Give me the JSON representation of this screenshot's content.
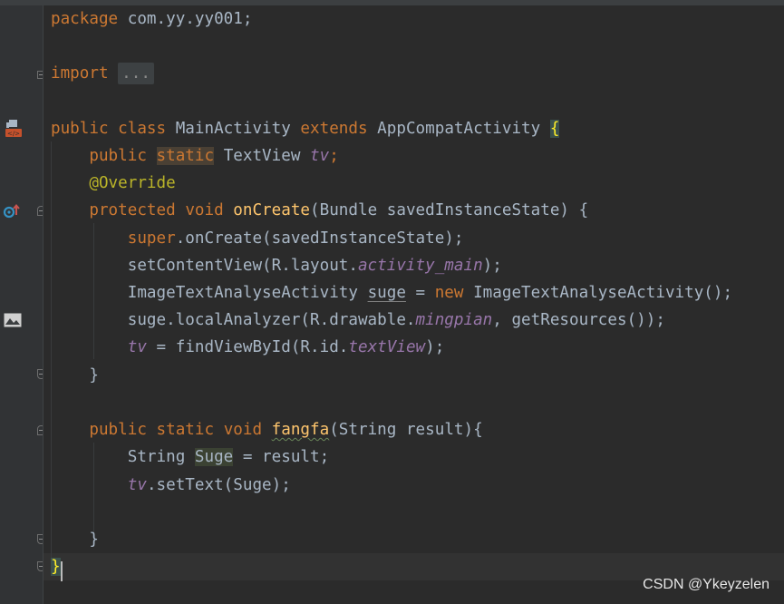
{
  "editor": {
    "lines": {
      "package": {
        "kw": "package",
        "rest": " com.yy.yy001;"
      },
      "import": {
        "kw": "import",
        "folded": "..."
      },
      "class_decl": {
        "kw1": "public",
        "kw2": "class",
        "name": "MainActivity",
        "kw3": "extends",
        "parent": "AppCompatActivity",
        "brace": "{"
      },
      "field_decl": {
        "kw1": "public",
        "kw2": "static",
        "type": "TextView",
        "field": "tv",
        "end": ";"
      },
      "override": {
        "text": "@Override"
      },
      "oncreate_decl": {
        "kw1": "protected",
        "kw2": "void",
        "name": "onCreate",
        "params": "(Bundle savedInstanceState) {"
      },
      "super_call": {
        "kw": "super",
        "rest": ".onCreate(savedInstanceState);"
      },
      "set_content": {
        "pre": "setContentView(R.layout.",
        "field": "activity_main",
        "post": ");"
      },
      "image_text": {
        "pre": "ImageTextAnalyseActivity ",
        "var": "suge",
        "mid": " = ",
        "kw": "new",
        "post": " ImageTextAnalyseActivity();"
      },
      "local_analyzer": {
        "pre": "suge.localAnalyzer(R.drawable.",
        "field": "mingpian",
        "post": ", getResources());"
      },
      "find_view": {
        "field": "tv",
        "pre": " = findViewById(R.id.",
        "field2": "textView",
        "post": ");"
      },
      "close1": {
        "text": "}"
      },
      "fangfa_decl": {
        "kw1": "public",
        "kw2": "static",
        "kw3": "void",
        "name": "fangfa",
        "params": "(String result){"
      },
      "string_decl": {
        "pre": "String ",
        "var": "Suge",
        "post": " = result;"
      },
      "set_text": {
        "field": "tv",
        "post": ".setText(Suge);"
      },
      "close2": {
        "text": "}"
      },
      "close_class": {
        "text": "}"
      }
    }
  },
  "watermark": "CSDN @Ykeyzelen",
  "icons": {
    "class_marker": "android-class-icon",
    "override_marker": "override-method-icon",
    "image_marker": "image-resource-icon"
  }
}
